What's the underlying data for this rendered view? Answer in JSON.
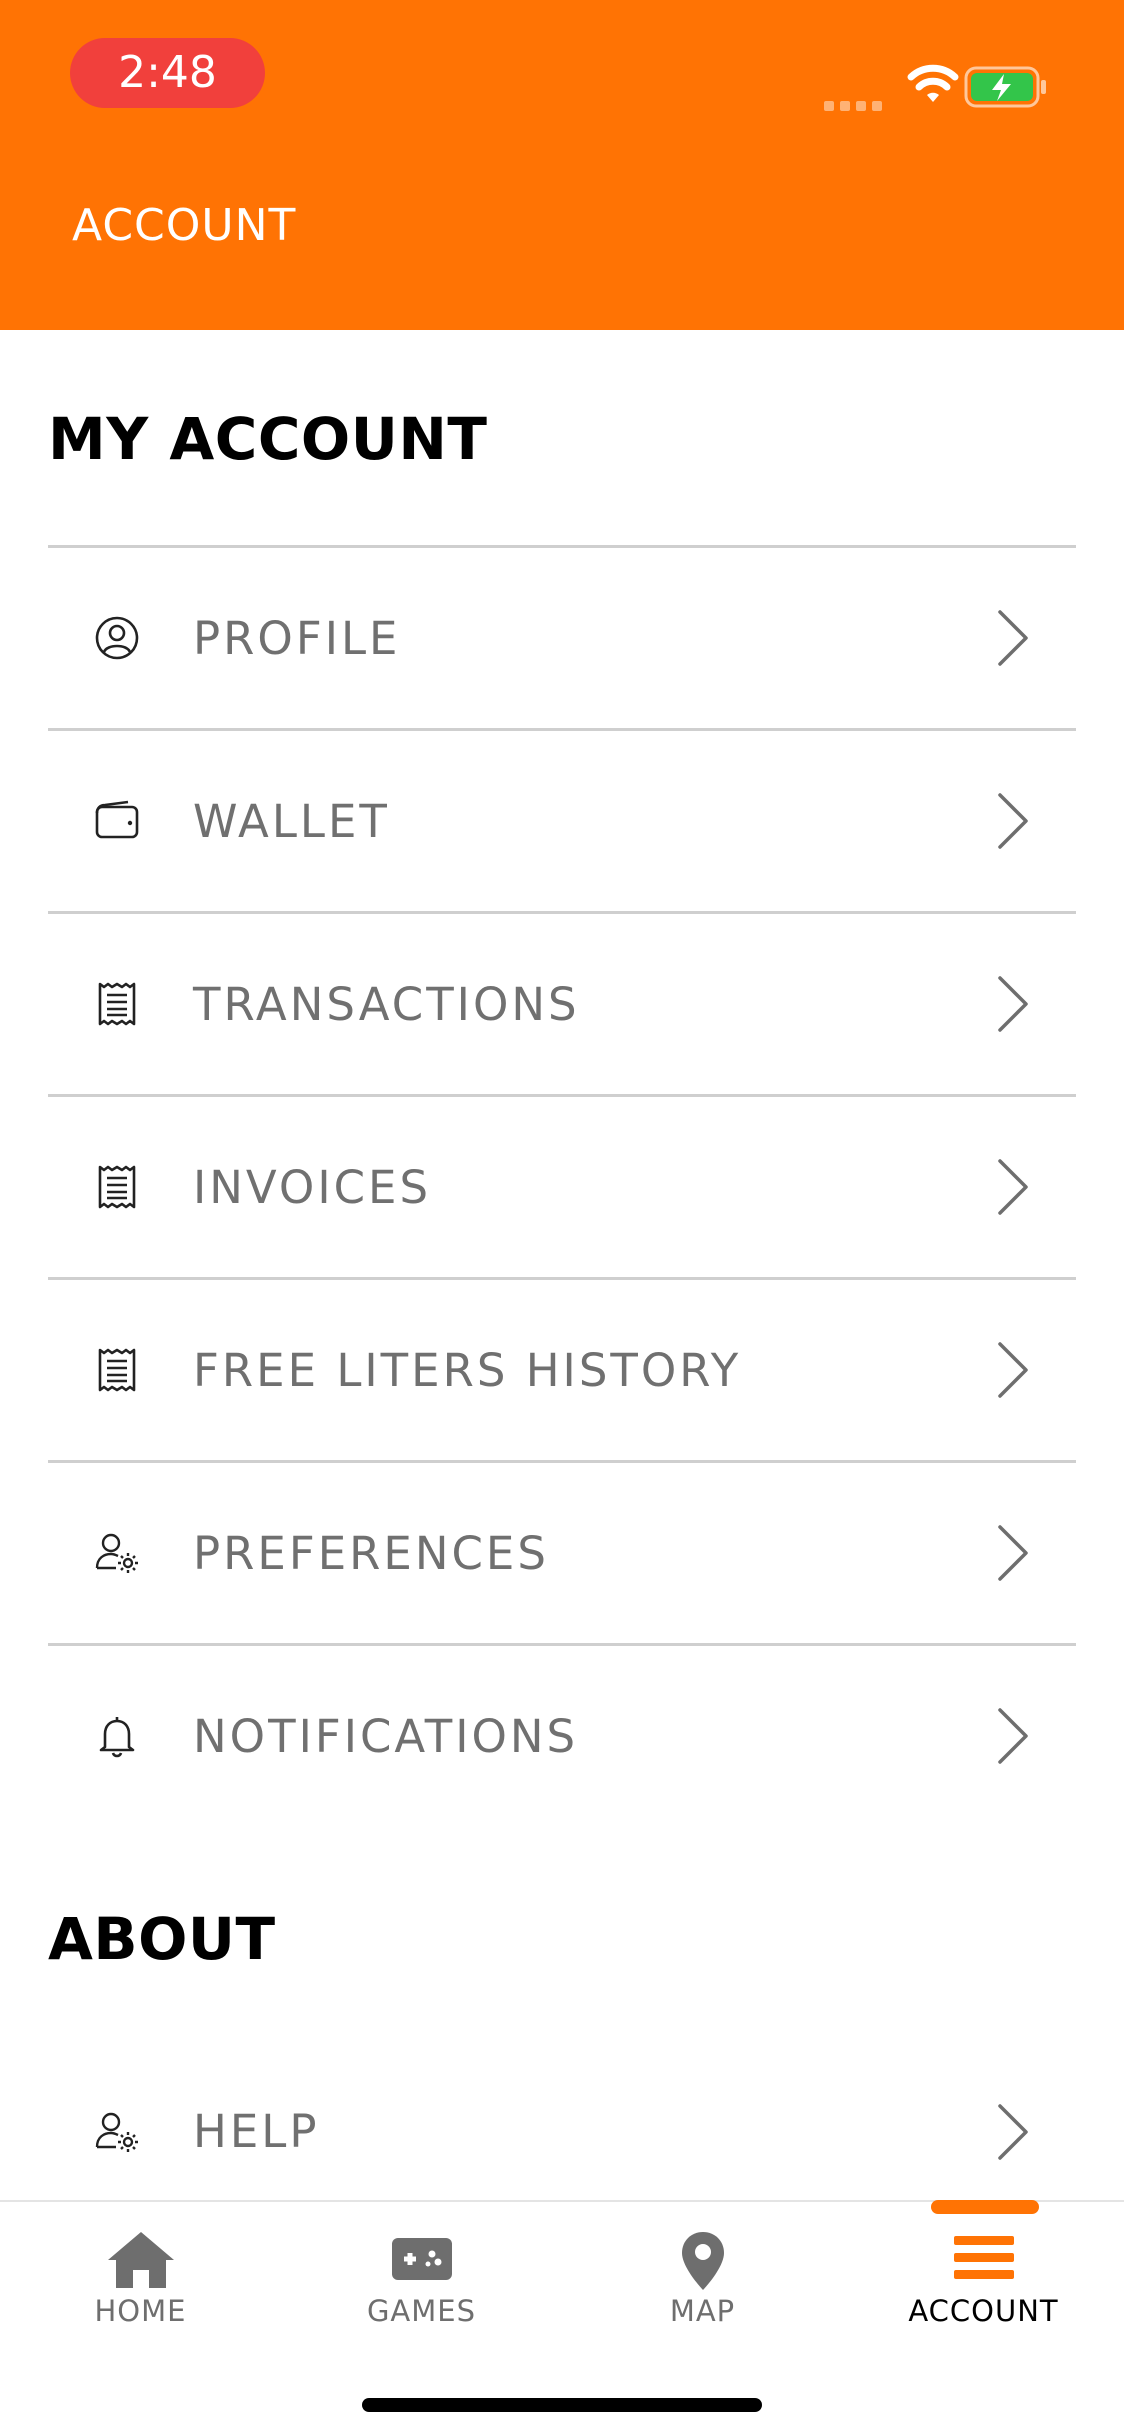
{
  "status_bar": {
    "time": "2:48",
    "icons": [
      "signal-icon",
      "wifi-icon",
      "battery-charging-icon"
    ]
  },
  "header": {
    "title": "ACCOUNT",
    "background": "#FF7304"
  },
  "sections": {
    "my_account": {
      "title": "MY ACCOUNT",
      "items": [
        {
          "label": "PROFILE",
          "icon": "profile-icon"
        },
        {
          "label": "WALLET",
          "icon": "wallet-icon"
        },
        {
          "label": "TRANSACTIONS",
          "icon": "receipt-icon"
        },
        {
          "label": "INVOICES",
          "icon": "receipt-icon"
        },
        {
          "label": "FREE LITERS HISTORY",
          "icon": "receipt-icon"
        },
        {
          "label": "PREFERENCES",
          "icon": "user-settings-icon"
        },
        {
          "label": "NOTIFICATIONS",
          "icon": "bell-icon"
        }
      ]
    },
    "about": {
      "title": "ABOUT",
      "items": [
        {
          "label": "HELP",
          "icon": "user-settings-icon"
        }
      ]
    }
  },
  "tabbar": {
    "tabs": [
      {
        "label": "HOME",
        "icon": "home-icon"
      },
      {
        "label": "GAMES",
        "icon": "gamepad-icon"
      },
      {
        "label": "MAP",
        "icon": "map-pin-icon"
      },
      {
        "label": "ACCOUNT",
        "icon": "menu-icon"
      }
    ],
    "active": "ACCOUNT"
  },
  "colors": {
    "accent": "#FF7304",
    "time_pill": "#F1403C",
    "label": "#707070",
    "divider": "#CFCFCF"
  }
}
